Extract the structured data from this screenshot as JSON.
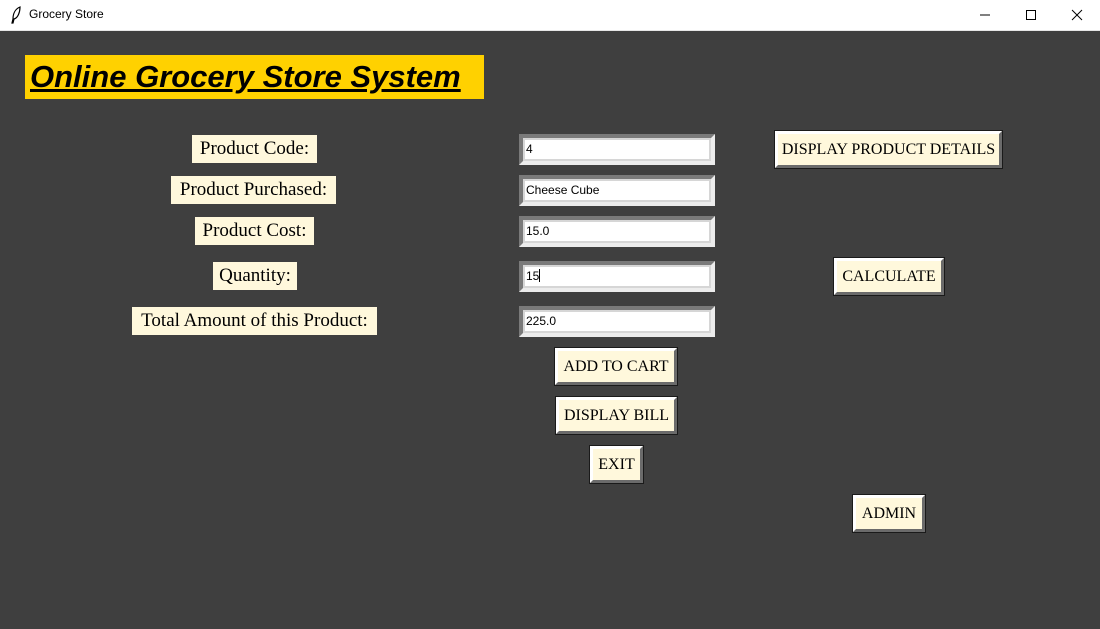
{
  "window": {
    "title": "Grocery Store"
  },
  "heading": "Online Grocery Store System",
  "labels": {
    "product_code": "Product Code:",
    "product_purchased": "Product Purchased:",
    "product_cost": "Product Cost:",
    "quantity": "Quantity:",
    "total_amount": "Total Amount of this Product:"
  },
  "fields": {
    "product_code": "4",
    "product_purchased": "Cheese Cube",
    "product_cost": "15.0",
    "quantity": "15",
    "total_amount": "225.0"
  },
  "buttons": {
    "display_product_details": "DISPLAY PRODUCT DETAILS",
    "calculate": "CALCULATE",
    "add_to_cart": "ADD TO CART",
    "display_bill": "DISPLAY BILL",
    "exit": "EXIT",
    "admin": "ADMIN"
  },
  "colors": {
    "background": "#3f3f3f",
    "heading_bg": "#ffd100",
    "label_bg": "#fff8dc"
  }
}
